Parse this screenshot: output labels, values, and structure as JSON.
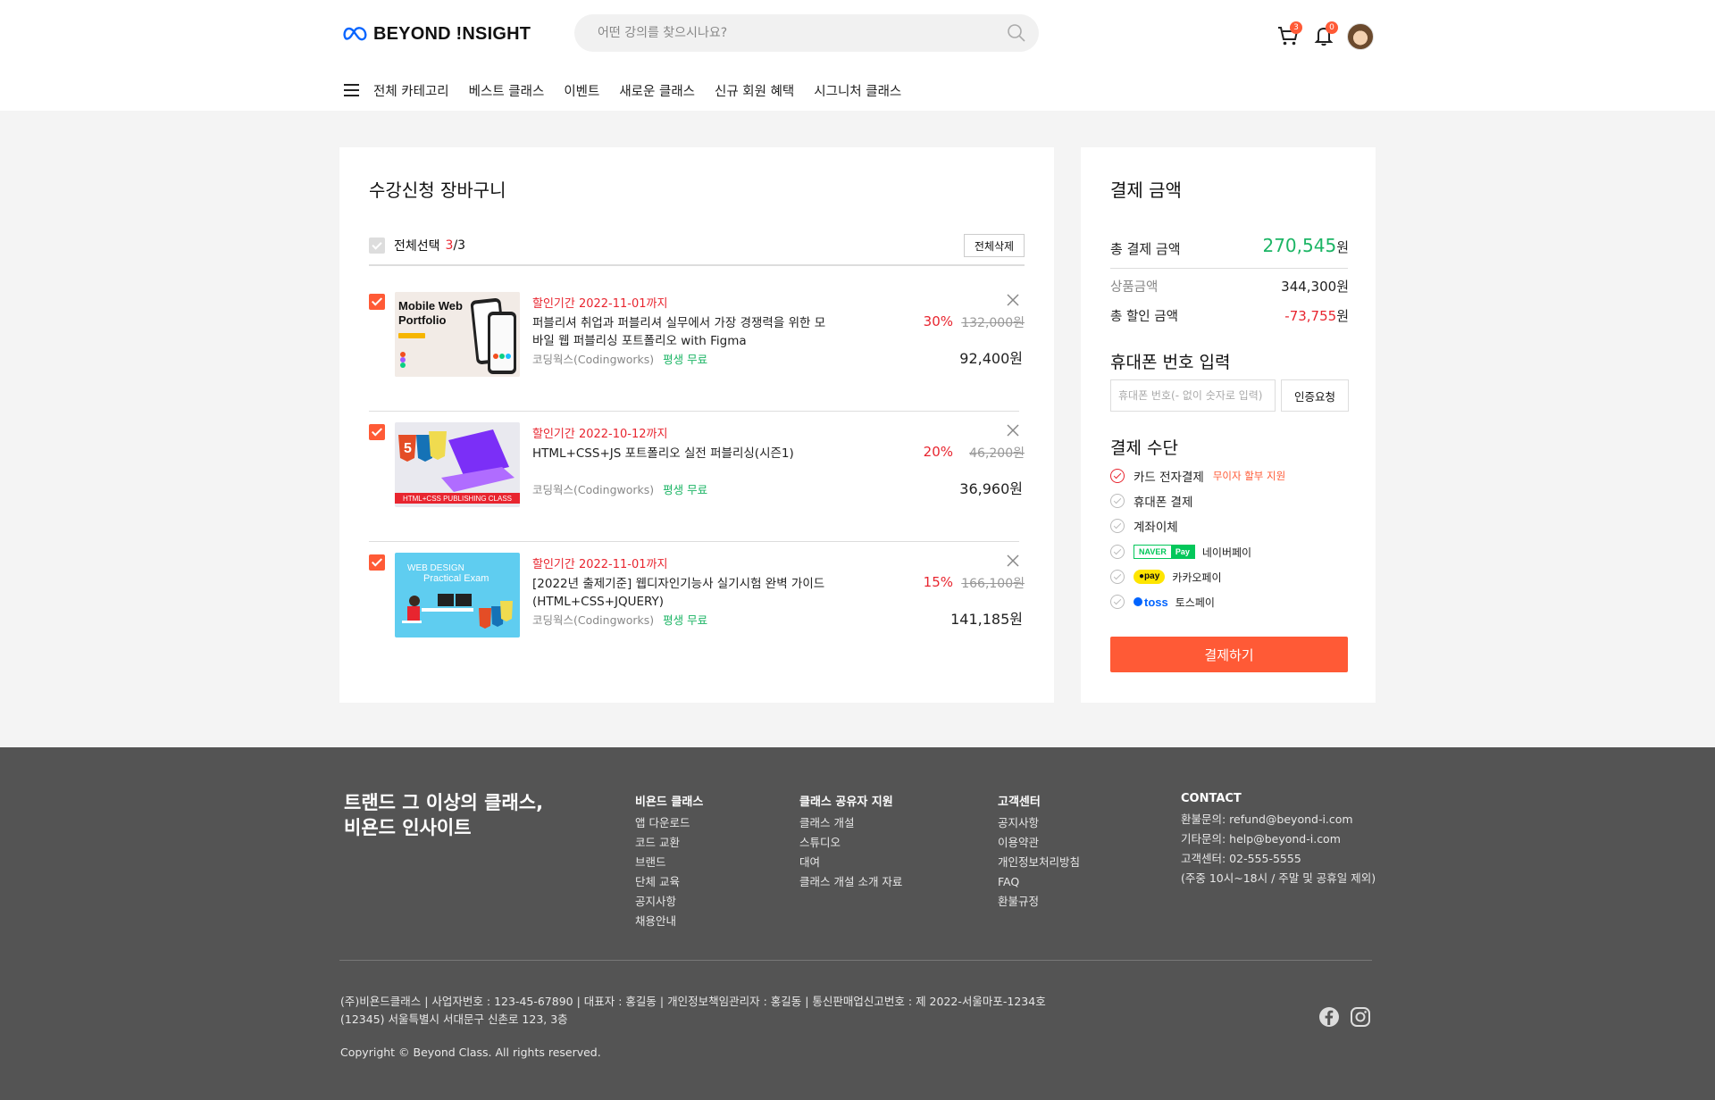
{
  "header": {
    "logo_text": "BEYOND !NSIGHT",
    "search_placeholder": "어떤 강의를 찾으시나요?",
    "cart_badge": "3",
    "notification_badge": "0"
  },
  "nav": {
    "items": [
      "전체 카테고리",
      "베스트 클래스",
      "이벤트",
      "새로운 클래스",
      "신규 회원 혜택",
      "시그니처 클래스"
    ]
  },
  "cart": {
    "title": "수강신청 장바구니",
    "select_all_label": "전체선택",
    "selected_count": "3",
    "total_count": "/3",
    "delete_all_label": "전체삭제",
    "items": [
      {
        "period": "할인기간 2022-11-01까지",
        "name": "퍼블리셔 취업과 퍼블리셔 실무에서 가장 경쟁력을 위한 모바일 웹 퍼블리싱 포트폴리오 with Figma",
        "instructor": "코딩웍스(Codingworks)",
        "access": "평생 무료",
        "discount_rate": "30%",
        "original_price": "132,000원",
        "price": "92,400원",
        "thumb_title": "Mobile Web Portfolio"
      },
      {
        "period": "할인기간 2022-10-12까지",
        "name": "HTML+CSS+JS 포트폴리오 실전 퍼블리싱(시즌1)",
        "instructor": "코딩웍스(Codingworks)",
        "access": "평생 무료",
        "discount_rate": "20%",
        "original_price": "46,200원",
        "price": "36,960원",
        "thumb_title": "HTML+CSS PUBLISHING CLASS"
      },
      {
        "period": "할인기간 2022-11-01까지",
        "name": "[2022년 출제기준] 웹디자인기능사 실기시험 완벽 가이드(HTML+CSS+JQUERY)",
        "instructor": "코딩웍스(Codingworks)",
        "access": "평생 무료",
        "discount_rate": "15%",
        "original_price": "166,100원",
        "price": "141,185원",
        "thumb_title": "WEB DESIGN Practical Exam"
      }
    ]
  },
  "payment": {
    "title": "결제 금액",
    "total_label": "총 결제 금액",
    "total_value": "270,545",
    "currency": "원",
    "product_label": "상품금액",
    "product_value": "344,300",
    "discount_label": "총 할인 금액",
    "discount_value": "-73,755",
    "phone_title": "휴대폰 번호 입력",
    "phone_placeholder": "휴대폰 번호(- 없이 숫자로 입력)",
    "auth_button": "인증요청",
    "method_title": "결제 수단",
    "methods": [
      {
        "label": "카드 전자결제",
        "hint": "무이자 할부 지원",
        "selected": true
      },
      {
        "label": "휴대폰 결제"
      },
      {
        "label": "계좌이체"
      },
      {
        "label": "네이버페이",
        "logo_a": "NAVER",
        "logo_b": "Pay"
      },
      {
        "label": "카카오페이",
        "logo": "pay"
      },
      {
        "label": "토스페이",
        "logo": "toss"
      }
    ],
    "pay_button": "결제하기"
  },
  "footer": {
    "slogan_line1": "트랜드 그 이상의  클래스,",
    "slogan_line2": "비욘드 인사이트",
    "columns": [
      {
        "title": "비욘드 클래스",
        "items": [
          "앱 다운로드",
          "코드 교환",
          "브랜드",
          "단체 교육",
          "공지사항",
          "채용안내"
        ]
      },
      {
        "title": "클래스 공유자 지원",
        "items": [
          "클래스 개설",
          "스튜디오",
          "대여",
          "클래스 개설 소개 자료"
        ]
      },
      {
        "title": "고객센터",
        "items": [
          "공지사항",
          "이용약관",
          "개인정보처리방침",
          "FAQ",
          "환불규정"
        ]
      },
      {
        "title": "CONTACT",
        "items": [
          "환불문의: refund@beyond-i.com",
          "기타문의: help@beyond-i.com",
          "고객센터: 02-555-5555",
          "(주중 10시~18시 / 주말 및 공휴일 제외)"
        ]
      }
    ],
    "company_info": "(주)비욘드클래스  |  사업자번호 : 123-45-67890  |  대표자 : 홍길동  |  개인정보책임관리자 : 홍길동  |  통신판매업신고번호 : 제 2022-서울마포-1234호",
    "address": "(12345) 서울특별시 서대문구 신촌로 123, 3층",
    "copyright": "Copyright © Beyond Class. All rights reserved."
  },
  "colors": {
    "accent": "#ff5a36",
    "discount_red": "#e8252f",
    "total_green": "#1cb565",
    "footer_bg": "#545454"
  }
}
